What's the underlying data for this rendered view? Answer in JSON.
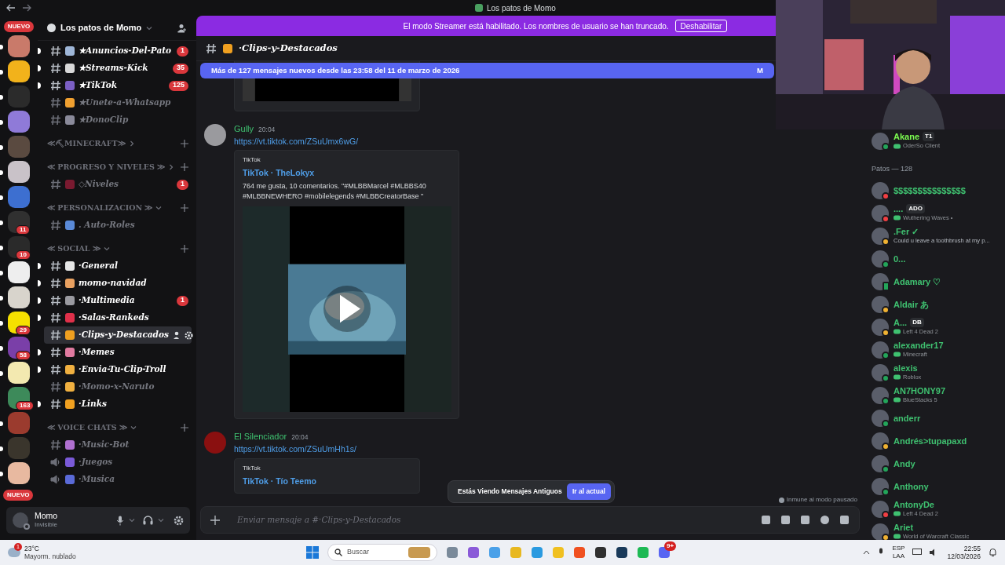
{
  "window": {
    "title": "Los patos de Momo"
  },
  "streamer_banner": {
    "text": "El modo Streamer está habilitado. Los nombres de usuario se han truncado.",
    "button": "Deshabilitar"
  },
  "rail": {
    "top_label": "NUEVO",
    "bottom_label": "NUEVO",
    "servers": [
      {
        "color": "#c97a6a",
        "unread": true
      },
      {
        "color": "#f2b21b",
        "unread": true
      },
      {
        "color": "#2b2b2b",
        "unread": true
      },
      {
        "color": "#8f7ad8",
        "unread": true
      },
      {
        "color": "#5a4a40",
        "unread": true
      },
      {
        "color": "#c9c2c8",
        "unread": true
      },
      {
        "color": "#3d6fd0",
        "unread": true
      },
      {
        "color": "#303030",
        "unread": true,
        "badge": "11"
      },
      {
        "color": "#2a2a2a",
        "unread": true,
        "badge": "10"
      },
      {
        "color": "#eeeeee",
        "unread": true
      },
      {
        "color": "#d8d4cc",
        "unread": true
      },
      {
        "color": "#f5e000",
        "unread": true,
        "badge": "29"
      },
      {
        "color": "#7a3fa8",
        "unread": true,
        "badge": "58"
      },
      {
        "color": "#f3e9b0",
        "unread": true
      },
      {
        "color": "#3d8a5a",
        "unread": false,
        "badge": "163"
      },
      {
        "color": "#9b3b2e",
        "unread": true
      },
      {
        "color": "#3a352c",
        "unread": true
      },
      {
        "color": "#e8b9a0",
        "unread": true
      }
    ]
  },
  "sidebar": {
    "server_name": "Los patos de Momo",
    "items": [
      {
        "kind": "text",
        "name": "★Anuncios-Del-Pato",
        "color": "#9fb7d8",
        "unread": true,
        "selected": false,
        "badge": "1"
      },
      {
        "kind": "text",
        "name": "★Streams-Kick",
        "color": "#d9d9d9",
        "unread": true,
        "selected": false,
        "badge": "35"
      },
      {
        "kind": "text",
        "name": "★TikTok",
        "color": "#7b5fc4",
        "unread": true,
        "selected": false,
        "badge": "125"
      },
      {
        "kind": "text",
        "name": "★Unete-a-Whatsapp",
        "color": "#f0a030",
        "unread": false,
        "selected": false
      },
      {
        "kind": "text",
        "name": "★DonoClip",
        "color": "#8a8a9a",
        "unread": false,
        "selected": false
      },
      {
        "kind": "category",
        "name": "≪⛏MINECRAFT≫",
        "expanded": false
      },
      {
        "kind": "category",
        "name": "≪ PROGRESO Y NIVELES ≫",
        "expanded": false,
        "children": [
          {
            "kind": "text",
            "name": "◇Niveles",
            "color": "#7a1a30",
            "unread": false,
            "selected": false,
            "badge": "1"
          }
        ]
      },
      {
        "kind": "category",
        "name": "≪ PERSONALIZACION ≫",
        "expanded": true,
        "children": [
          {
            "kind": "text",
            "name": ". Auto-Roles",
            "color": "#5a8ad8",
            "unread": false,
            "selected": false
          }
        ]
      },
      {
        "kind": "category",
        "name": "≪ SOCIAL ≫",
        "expanded": true,
        "children": [
          {
            "kind": "text",
            "name": "·General",
            "color": "#e6e6e6",
            "unread": true,
            "selected": false
          },
          {
            "kind": "text",
            "name": "momo-navidad",
            "color": "#e8a060",
            "unread": true,
            "selected": false
          },
          {
            "kind": "text",
            "name": "·Multimedia",
            "color": "#9a9aa0",
            "unread": true,
            "selected": false,
            "badge": "1"
          },
          {
            "kind": "text",
            "name": "·Salas-Rankeds",
            "color": "#e0304a",
            "unread": true,
            "selected": false
          },
          {
            "kind": "text",
            "name": "·Clips-y-Destacados",
            "color": "#f0a020",
            "unread": false,
            "selected": true
          },
          {
            "kind": "text",
            "name": "·Memes",
            "color": "#e07aa0",
            "unread": true,
            "selected": false
          },
          {
            "kind": "text",
            "name": "·Envia-Tu-Clip-Troll",
            "color": "#f0b040",
            "unread": true,
            "selected": false
          },
          {
            "kind": "text",
            "name": "·Momo-x-Naruto",
            "color": "#f0b040",
            "unread": false,
            "selected": false
          },
          {
            "kind": "text",
            "name": "·Links",
            "color": "#f0a020",
            "unread": true,
            "selected": false
          }
        ]
      },
      {
        "kind": "category",
        "name": "≪ VOICE CHATS ≫",
        "expanded": true,
        "children": [
          {
            "kind": "text",
            "name": "·Music-Bot",
            "color": "#b070d0",
            "unread": false,
            "selected": false
          },
          {
            "kind": "voice",
            "name": "·Juegos",
            "color": "#7a5ad8",
            "unread": false,
            "selected": false
          },
          {
            "kind": "voice",
            "name": "·Musica",
            "color": "#5a6ad8",
            "unread": false,
            "selected": false
          }
        ]
      }
    ]
  },
  "user_panel": {
    "name": "Momo",
    "status": "Invisible"
  },
  "channel_header": {
    "name": "·Clips-y-Destacados"
  },
  "new_messages_bar": {
    "text": "Más de 127 mensajes nuevos desde las 23:58 del 11 de marzo de 2026",
    "cut_text": "M"
  },
  "messages": [
    {
      "author": "Gully",
      "time": "20:04",
      "link": "https://vt.tiktok.com/ZSuUmx6wG/",
      "embed": {
        "provider": "TikTok",
        "title": "TikTok · TheLokyx",
        "description": "764 me gusta, 10 comentarios. \"#MLBBMarcel #MLBBS40 #MLBBNEWHERO #mobilelegends #MLBBCreatorBase \"",
        "media": {
          "kind": "video"
        }
      }
    },
    {
      "author": "El Silenciador",
      "time": "20:04",
      "link": "https://vt.tiktok.com/ZSuUmHh1s/",
      "embed": {
        "provider": "TikTok",
        "title": "TikTok · Tío Teemo"
      }
    }
  ],
  "jump_popup": {
    "text": "Estás Viendo Mensajes Antiguos",
    "button": "Ir al actual"
  },
  "pause_note": "Inmune al modo pausado",
  "composer": {
    "placeholder": "Enviar mensaje a #·Clips-y-Destacados"
  },
  "members": {
    "groups": [
      {
        "members": [
          {
            "name": "Akane",
            "tag": "T1",
            "activity": {
              "kind": "game",
              "text": "OderSo Client"
            },
            "kind": "online"
          }
        ]
      },
      {
        "label": "Patos — 128",
        "members": [
          {
            "name": "$$$$$$$$$$$$$$$",
            "kind": "dnd"
          },
          {
            "name": "....",
            "tag": "ADO",
            "activity": {
              "kind": "game",
              "text": "Wuthering Waves •"
            },
            "kind": "dnd"
          },
          {
            "name": ".Fer ✓",
            "activity": {
              "kind": "custom",
              "text": "Could u leave a toothbrush at my p..."
            },
            "kind": "idle"
          },
          {
            "name": "0...",
            "kind": "online"
          },
          {
            "name": "Adamary ♡",
            "kind": "mobile"
          },
          {
            "name": "Aldair あ",
            "kind": "idle"
          },
          {
            "name": "A...",
            "tag": "DB",
            "activity": {
              "kind": "game",
              "text": "Left 4 Dead 2"
            },
            "kind": "idle"
          },
          {
            "name": "alexander17",
            "activity": {
              "kind": "game",
              "text": "Minecraft"
            },
            "kind": "online"
          },
          {
            "name": "alexis",
            "activity": {
              "kind": "game",
              "text": "Roblox"
            },
            "kind": "online"
          },
          {
            "name": "AN7HONY97",
            "activity": {
              "kind": "game",
              "text": "BlueStacks 5"
            },
            "kind": "online"
          },
          {
            "name": "anderr",
            "kind": "online"
          },
          {
            "name": "Andrés>tupapaxd",
            "kind": "idle"
          },
          {
            "name": "Andy",
            "kind": "online"
          },
          {
            "name": "Anthony",
            "kind": "online"
          },
          {
            "name": "AntonyDe",
            "activity": {
              "kind": "game",
              "text": "Left 4 Dead 2"
            },
            "kind": "dnd"
          },
          {
            "name": "Ariet",
            "activity": {
              "kind": "game",
              "text": "World of Warcraft Classic"
            },
            "kind": "idle"
          }
        ]
      }
    ]
  },
  "taskbar": {
    "weather_badge": "1",
    "temperature": "23°C",
    "weather": "Mayorm. nublado",
    "search_placeholder": "Buscar",
    "discord_badge": "9+",
    "language": "ESP",
    "layout": "LAA",
    "time": "22:55",
    "date": "12/03/2026"
  }
}
